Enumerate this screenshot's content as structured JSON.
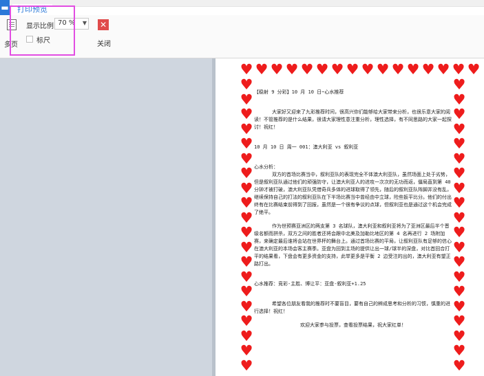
{
  "app": {
    "tab_icon": "▬",
    "active_tab": "打印预览"
  },
  "ribbon": {
    "multi_page_label": "多页",
    "zoom_label": "显示比例",
    "zoom_value": "70 %",
    "ruler_label": "标尺",
    "ruler_checked": false,
    "close_label": "关闭",
    "close_color": "#e04b4b",
    "highlight_color": "#e24ce2"
  },
  "document": {
    "border_icon": "heart-icon",
    "border_color": "#ee1c1c",
    "title": "【稳射 9 分彩】10 月 10 日~心水推荐",
    "intro": "大家好又迎来了九彩推荐时间，很高兴你们能够给大家带来分析，也很乐意大家的阅读！不管推荐的是什么结果，很请大家理性意注重分析，理性选择，有不同思路的大家一起探讨！祝红！",
    "match": "10 月 10 日 周一 001：澳大利亚 vs 叙利亚",
    "analysis_heading": "心水分析：",
    "para1": "双方的首场比赛当中，叙利亚队的表现完全不体澳大利亚队，虽然场面上处于劣势，但是叙利亚队通过他们的顽强防守，让澳大利亚人的进攻一次次的无功而返，僵局直到第 40 分钟才被打破，澳大利亚队凭借奇兵多体的进球取得了领先，随后的叙利亚队阵脚并没有乱，继续保持自己的打法的叙利亚队在下半场比赛当中曾经由中立球，险些扳平比分。他们的付出终有在比赛结束前得到了回报，虽然是一个很有争议的点球，但叙利亚也是通过这个机会完成了绝平。",
    "para2": "作为世预赛亚洲区的两支第 3 名球队，澳大利亚和叙利亚将为了亚洲区最后半个晋级名额而拼杀，双方之间的胜者还将会跟中北美及加勒比地区的第 4 名再进行 2 场附加赛，来确定最后谁将会站在世界杯的舞台上。通过首场比赛的平局，让叙利亚队有足够的信心在澳大利亚的本场会客主赛季。亚盘为回到主场的提供让出一球/球半的深盘，对比首回合打平的结果看，下盘会有更多资金的支持，此举更多是平衡 2 边受注的出的，澳大利亚有望正路打出。",
    "recommend": "心水推荐：竞彩-主胜、博让平：亚盘-叙利亚+1.25",
    "outro": "希望各位朋友看我的推荐时不要盲目，要有自己的辨成思考和分析的习惯，慎重的进行选择！祝红！",
    "closing": "欢迎大家参与投票，查看投票结果，祝大家红单！"
  }
}
